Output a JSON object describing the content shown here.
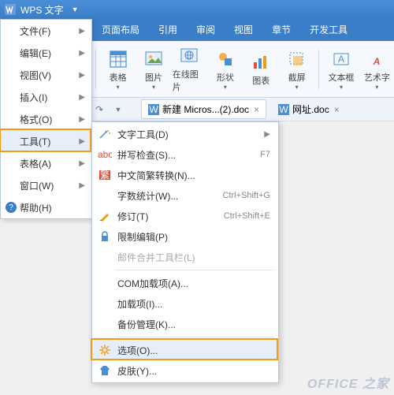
{
  "titlebar": {
    "app": "WPS 文字"
  },
  "ribbon": {
    "tabs": [
      "页面布局",
      "引用",
      "审阅",
      "视图",
      "章节",
      "开发工具"
    ],
    "buttons": [
      {
        "label": "表格"
      },
      {
        "label": "图片"
      },
      {
        "label": "在线图片"
      },
      {
        "label": "形状"
      },
      {
        "label": "图表"
      },
      {
        "label": "截屏"
      },
      {
        "label": "文本框"
      },
      {
        "label": "艺术字"
      }
    ]
  },
  "docs": [
    {
      "name": "新建 Micros...(2).doc",
      "active": true
    },
    {
      "name": "网址.doc",
      "active": false
    }
  ],
  "main_menu": [
    {
      "label": "文件(F)",
      "arrow": true
    },
    {
      "label": "编辑(E)",
      "arrow": true
    },
    {
      "label": "视图(V)",
      "arrow": true
    },
    {
      "label": "插入(I)",
      "arrow": true
    },
    {
      "label": "格式(O)",
      "arrow": true
    },
    {
      "label": "工具(T)",
      "arrow": true,
      "highlight": true
    },
    {
      "label": "表格(A)",
      "arrow": true
    },
    {
      "label": "窗口(W)",
      "arrow": true
    },
    {
      "label": "帮助(H)",
      "arrow": false,
      "help": true
    }
  ],
  "sub_menu": [
    {
      "icon": "wand",
      "label": "文字工具(D)",
      "arrow": true
    },
    {
      "icon": "abc",
      "label": "拼写检查(S)...",
      "shortcut": "F7"
    },
    {
      "icon": "cn",
      "label": "中文简繁转换(N)..."
    },
    {
      "icon": "",
      "label": "字数统计(W)...",
      "shortcut": "Ctrl+Shift+G"
    },
    {
      "icon": "pen",
      "label": "修订(T)",
      "shortcut": "Ctrl+Shift+E"
    },
    {
      "icon": "lock",
      "label": "限制编辑(P)"
    },
    {
      "icon": "",
      "label": "邮件合并工具栏(L)",
      "disabled": true,
      "sep_after": true
    },
    {
      "icon": "",
      "label": "COM加载项(A)..."
    },
    {
      "icon": "",
      "label": "加载项(I)..."
    },
    {
      "icon": "",
      "label": "备份管理(K)...",
      "sep_after": true
    },
    {
      "icon": "gear",
      "label": "选项(O)...",
      "highlight": true
    },
    {
      "icon": "shirt",
      "label": "皮肤(Y)..."
    }
  ],
  "watermark": "OFFICE 之家"
}
